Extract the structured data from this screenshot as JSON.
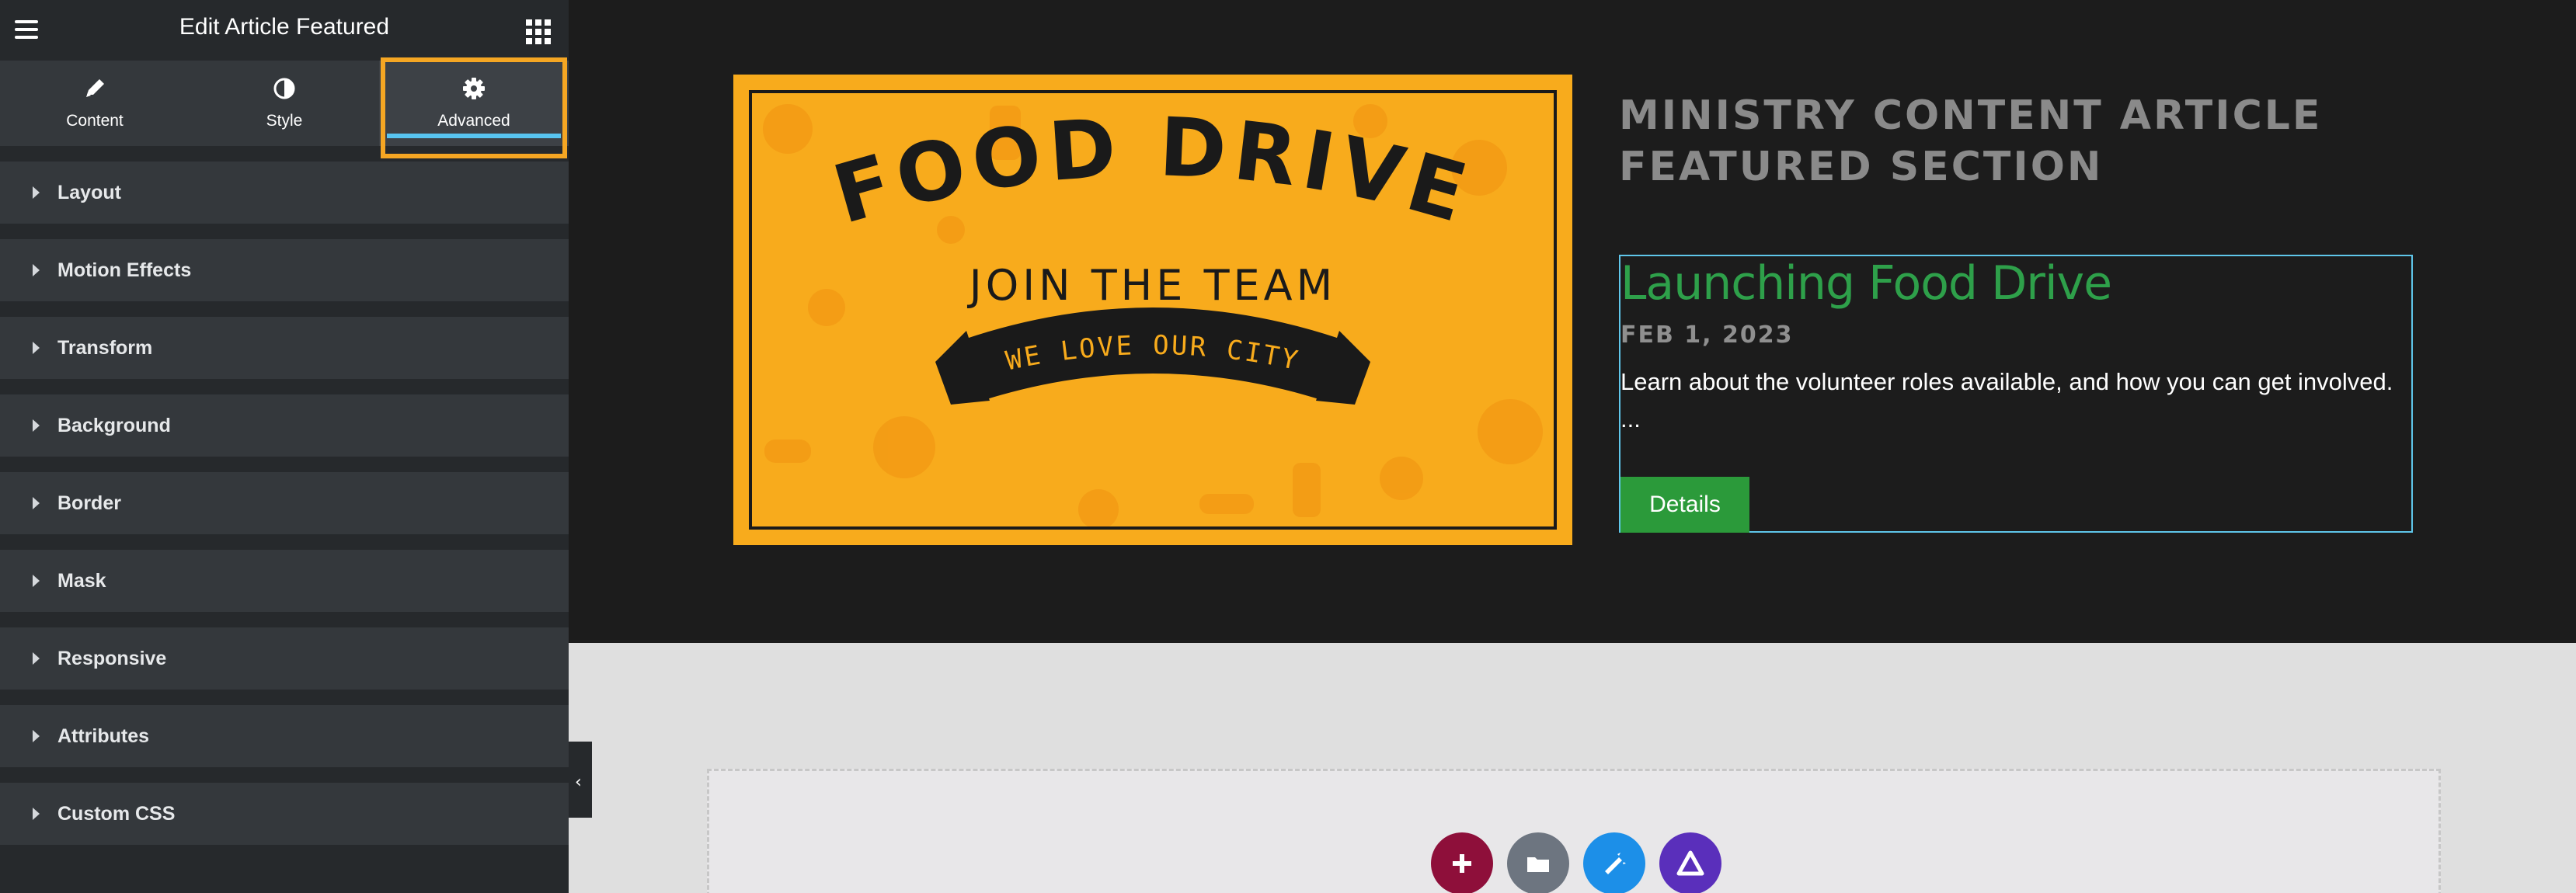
{
  "sidebar": {
    "title": "Edit Article Featured",
    "tabs": [
      {
        "label": "Content",
        "icon": "pencil-icon"
      },
      {
        "label": "Style",
        "icon": "contrast-icon"
      },
      {
        "label": "Advanced",
        "icon": "gear-icon"
      }
    ],
    "active_tab": "Advanced",
    "sections": [
      "Layout",
      "Motion Effects",
      "Transform",
      "Background",
      "Border",
      "Mask",
      "Responsive",
      "Attributes",
      "Custom CSS"
    ]
  },
  "canvas": {
    "image": {
      "line1": "FOOD DRIVE",
      "line2": "JOIN THE TEAM",
      "line3": "WE LOVE OUR CITY"
    },
    "section_heading": "MINISTRY CONTENT ARTICLE FEATURED SECTION",
    "article": {
      "title": "Launching Food Drive",
      "date": "FEB 1, 2023",
      "excerpt": "Learn about the volunteer roles available, and how you can get involved. ...",
      "button": "Details"
    },
    "drop_zone_buttons": [
      "add-section",
      "template-library",
      "ai-assistant",
      "kit"
    ]
  },
  "colors": {
    "sidebar_bg": "#26292c",
    "panel_bg": "#34383c",
    "active_tab_accent": "#58c4f0",
    "highlight": "#f5a623",
    "image_bg": "#f8ab1c",
    "article_title": "#2ea04a",
    "button_bg": "#2b9a3a"
  }
}
